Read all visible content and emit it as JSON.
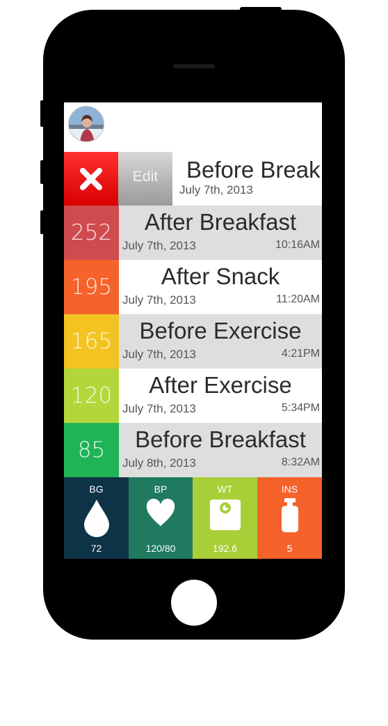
{
  "swiped_row": {
    "delete_label": "✕",
    "edit_label": "Edit",
    "title": "Before Break",
    "date": "July 7th, 2013"
  },
  "readings": [
    {
      "value": "252",
      "title": "After Breakfast",
      "date": "July 7th, 2013",
      "time": "10:16AM",
      "color": "#cf4b4e"
    },
    {
      "value": "195",
      "title": "After Snack",
      "date": "July 7th, 2013",
      "time": "11:20AM",
      "color": "#f5622a"
    },
    {
      "value": "165",
      "title": "Before Exercise",
      "date": "July 7th, 2013",
      "time": "4:21PM",
      "color": "#f2c321"
    },
    {
      "value": "120",
      "title": "After Exercise",
      "date": "July 7th, 2013",
      "time": "5:34PM",
      "color": "#b3d73b"
    },
    {
      "value": "85",
      "title": "Before Breakfast",
      "date": "July 8th, 2013",
      "time": "8:32AM",
      "color": "#1fb456"
    }
  ],
  "tabs": [
    {
      "label": "BG",
      "value": "72",
      "icon": "drop-icon",
      "color": "#0e3246"
    },
    {
      "label": "BP",
      "value": "120/80",
      "icon": "heart-icon",
      "color": "#1f7a60"
    },
    {
      "label": "WT",
      "value": "192.6",
      "icon": "scale-icon",
      "color": "#a8cf38"
    },
    {
      "label": "INS",
      "value": "5",
      "icon": "insulin-bottle-icon",
      "color": "#f5622a"
    }
  ]
}
